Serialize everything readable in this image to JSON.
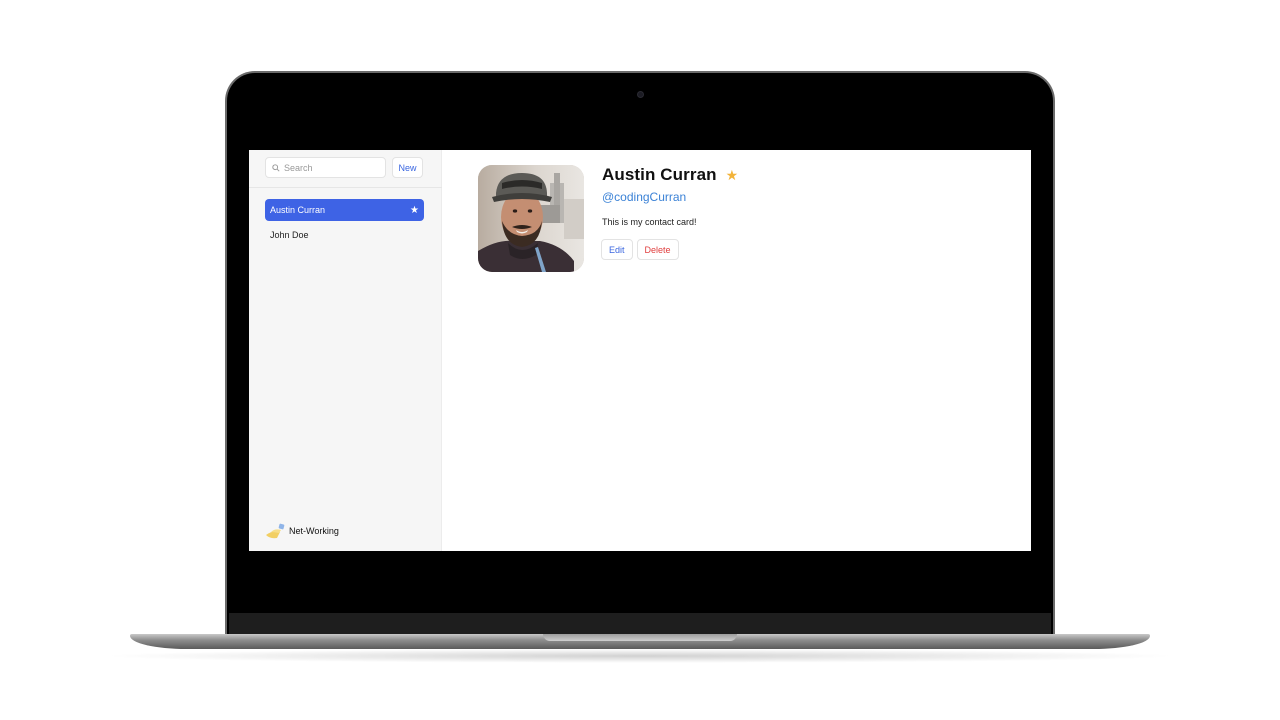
{
  "sidebar": {
    "search_placeholder": "Search",
    "new_label": "New",
    "contacts": [
      {
        "name": "Austin Curran",
        "favorite": true,
        "selected": true
      },
      {
        "name": "John Doe",
        "favorite": false,
        "selected": false
      }
    ],
    "brand": "Net-Working"
  },
  "detail": {
    "name": "Austin Curran",
    "favorite_glyph": "★",
    "handle": "@codingCurran",
    "notes": "This is my contact card!",
    "edit_label": "Edit",
    "delete_label": "Delete"
  },
  "colors": {
    "accent": "#3e63e5",
    "link": "#3b82d6",
    "favorite": "#f2b33a",
    "danger": "#e03e3e"
  },
  "icons": {
    "search": "search-icon",
    "favorite": "star-icon",
    "logo": "net-working-logo"
  }
}
